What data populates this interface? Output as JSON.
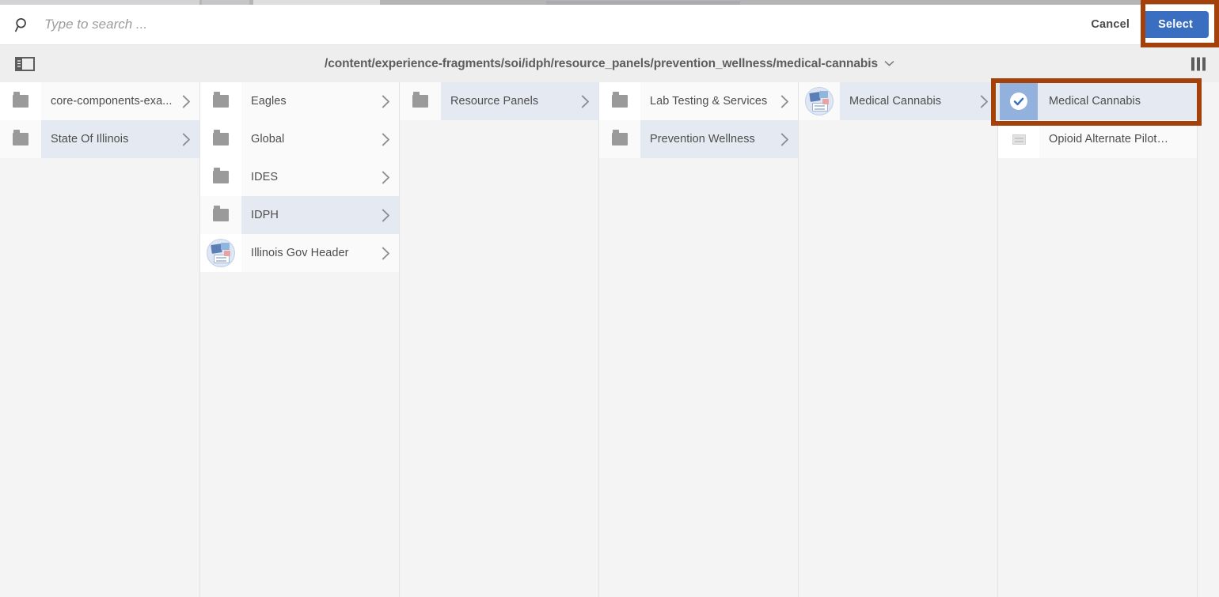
{
  "header": {
    "search_placeholder": "Type to search ...",
    "search_value": "",
    "search_icon": "search-icon",
    "cancel_label": "Cancel",
    "select_label": "Select",
    "select_button_color": "#3a6ec1",
    "annotation_color": "#a4400a"
  },
  "pathbar": {
    "panel_toggle_icon": "sidebar-toggle-icon",
    "path": "/content/experience-fragments/soi/idph/resource_panels/prevention_wellness/medical-cannabis",
    "caret_icon": "chevron-down-icon",
    "columns_view_icon": "column-view-icon"
  },
  "columns": [
    {
      "id": "column-1",
      "rows": [
        {
          "label": "core-components-exa...",
          "icon": "folder-icon",
          "selected": false,
          "has_chevron": true
        },
        {
          "label": "State Of Illinois",
          "icon": "folder-icon",
          "selected": true,
          "has_chevron": true
        }
      ]
    },
    {
      "id": "column-2",
      "rows": [
        {
          "label": "Eagles",
          "icon": "folder-icon",
          "selected": false,
          "has_chevron": true
        },
        {
          "label": "Global",
          "icon": "folder-icon",
          "selected": false,
          "has_chevron": true
        },
        {
          "label": "IDES",
          "icon": "folder-icon",
          "selected": false,
          "has_chevron": true
        },
        {
          "label": "IDPH",
          "icon": "folder-icon",
          "selected": true,
          "has_chevron": true
        },
        {
          "label": "Illinois Gov Header",
          "icon": "experience-fragment-thumbnail",
          "selected": false,
          "has_chevron": true
        }
      ]
    },
    {
      "id": "column-3",
      "rows": [
        {
          "label": "Resource Panels",
          "icon": "folder-icon",
          "selected": true,
          "has_chevron": true
        }
      ]
    },
    {
      "id": "column-4",
      "rows": [
        {
          "label": "Lab Testing & Services",
          "icon": "folder-icon",
          "selected": false,
          "has_chevron": true
        },
        {
          "label": "Prevention Wellness",
          "icon": "folder-icon",
          "selected": true,
          "has_chevron": true
        }
      ]
    },
    {
      "id": "column-5",
      "rows": [
        {
          "label": "Medical Cannabis",
          "icon": "experience-fragment-thumbnail",
          "selected": true,
          "has_chevron": true
        }
      ]
    },
    {
      "id": "column-6",
      "rows": [
        {
          "label": "Medical Cannabis",
          "icon": "checked-thumbnail",
          "selected": true,
          "has_chevron": false,
          "annotated": true
        },
        {
          "label": "Opioid Alternate Pilot Program",
          "icon": "page-icon",
          "selected": false,
          "has_chevron": false
        }
      ]
    }
  ]
}
